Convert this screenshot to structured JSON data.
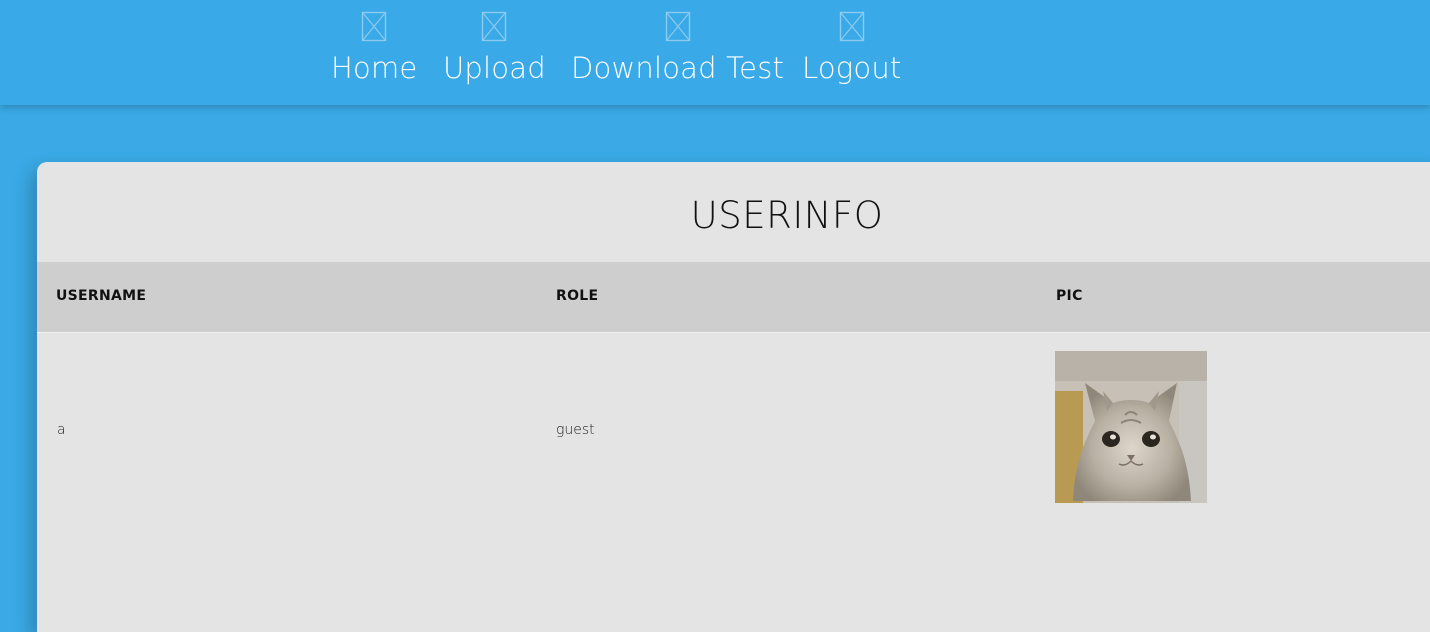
{
  "nav": {
    "items": [
      {
        "label": "Home",
        "icon": "broken-image-icon"
      },
      {
        "label": "Upload",
        "icon": "broken-image-icon"
      },
      {
        "label": "Download Test",
        "icon": "broken-image-icon"
      },
      {
        "label": "Logout",
        "icon": "broken-image-icon"
      }
    ]
  },
  "card": {
    "title": "USERINFO"
  },
  "table": {
    "headers": [
      "USERNAME",
      "ROLE",
      "PIC"
    ],
    "rows": [
      {
        "username": "a",
        "role": "guest",
        "pic": "cat-avatar-image"
      }
    ]
  },
  "colors": {
    "background": "#3aa9e5",
    "navbar": "#3aa9e8",
    "card": "#e4e4e4",
    "table_header": "#cecece"
  }
}
